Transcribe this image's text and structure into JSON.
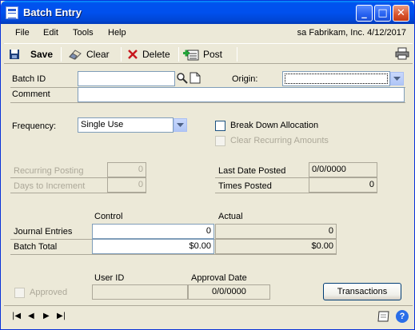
{
  "window": {
    "title": "Batch Entry",
    "minimize": "_",
    "maximize": "□",
    "close": "✕"
  },
  "menu": {
    "file": "File",
    "edit": "Edit",
    "tools": "Tools",
    "help": "Help",
    "status_user": "sa",
    "status_company": "Fabrikam, Inc.",
    "status_date": "4/12/2017"
  },
  "toolbar": {
    "save": "Save",
    "clear": "Clear",
    "delete": "Delete",
    "post": "Post"
  },
  "form": {
    "batch_id_label": "Batch ID",
    "batch_id_value": "",
    "origin_label": "Origin:",
    "origin_value": "",
    "comment_label": "Comment",
    "comment_value": "",
    "frequency_label": "Frequency:",
    "frequency_value": "Single Use",
    "break_down_label": "Break Down Allocation",
    "clear_recurring_label": "Clear Recurring Amounts",
    "recurring_posting_label": "Recurring Posting",
    "recurring_posting_value": "0",
    "days_increment_label": "Days to Increment",
    "days_increment_value": "0",
    "last_date_posted_label": "Last Date Posted",
    "last_date_posted_value": "0/0/0000",
    "times_posted_label": "Times Posted",
    "times_posted_value": "0"
  },
  "totals": {
    "control_header": "Control",
    "actual_header": "Actual",
    "journal_entries_label": "Journal Entries",
    "journal_control": "0",
    "journal_actual": "0",
    "batch_total_label": "Batch Total",
    "batch_control": "$0.00",
    "batch_actual": "$0.00"
  },
  "approval": {
    "approved_label": "Approved",
    "user_id_header": "User ID",
    "user_id_value": "",
    "approval_date_header": "Approval Date",
    "approval_date_value": "0/0/0000",
    "transactions_button": "Transactions"
  },
  "status": {
    "first": "|◀",
    "prev": "◀",
    "next": "▶",
    "last": "▶|",
    "help": "?"
  }
}
